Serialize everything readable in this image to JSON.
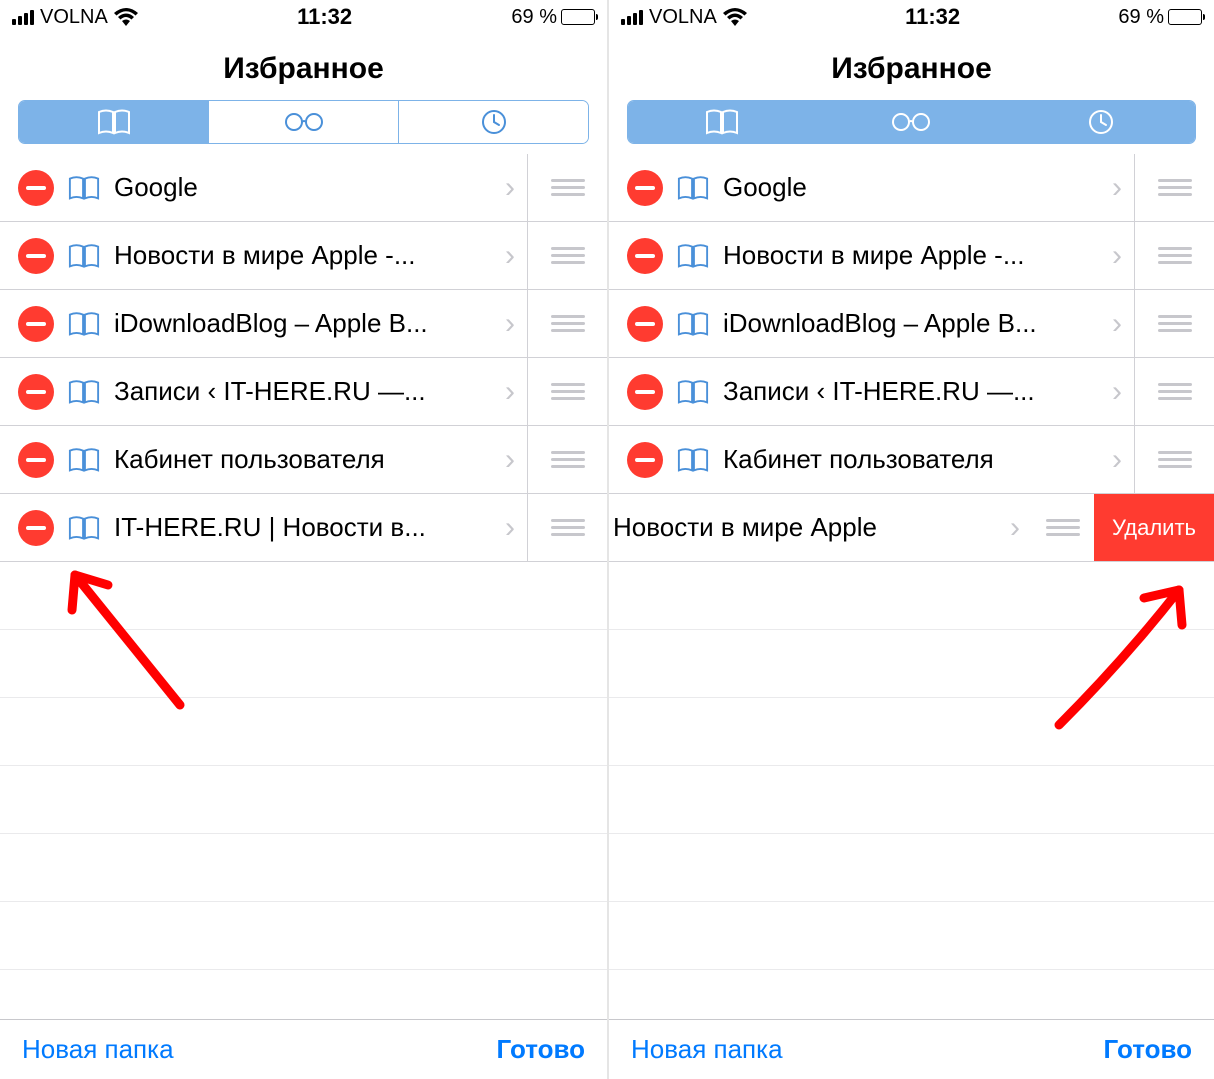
{
  "status": {
    "carrier": "VOLNA",
    "time": "11:32",
    "battery_text": "69 %"
  },
  "header": {
    "title": "Избранное"
  },
  "left": {
    "items": [
      {
        "label": "Google"
      },
      {
        "label": "Новости в мире Apple -..."
      },
      {
        "label": "iDownloadBlog – Apple B..."
      },
      {
        "label": "Записи ‹ IT-HERE.RU —..."
      },
      {
        "label": "Кабинет пользователя"
      },
      {
        "label": "IT-HERE.RU | Новости в..."
      }
    ]
  },
  "right": {
    "items": [
      {
        "label": "Google"
      },
      {
        "label": "Новости в мире Apple -..."
      },
      {
        "label": "iDownloadBlog – Apple B..."
      },
      {
        "label": "Записи ‹ IT-HERE.RU —..."
      },
      {
        "label": "Кабинет пользователя"
      }
    ],
    "shifted_item": {
      "label": "Новости в мире Apple"
    },
    "delete_label": "Удалить"
  },
  "toolbar": {
    "new_folder": "Новая папка",
    "done": "Готово"
  }
}
